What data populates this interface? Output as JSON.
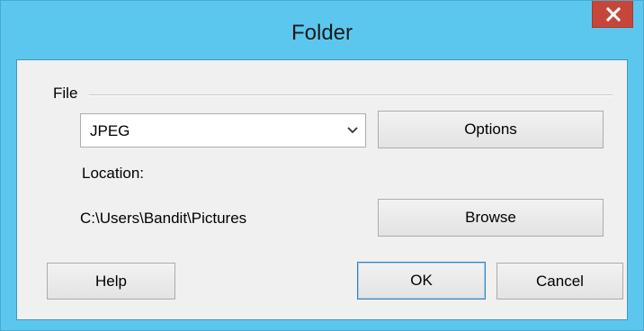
{
  "window": {
    "title": "Folder",
    "close_icon": "close-icon",
    "colors": {
      "titlebar": "#5cc7ee",
      "close_button": "#c7463a",
      "client_background": "#f0f0f0"
    }
  },
  "file_group": {
    "label": "File",
    "format_select": {
      "value": "JPEG",
      "arrow_icon": "chevron-down-icon"
    },
    "options_label": "Options"
  },
  "location": {
    "label": "Location:",
    "path": "C:\\Users\\Bandit\\Pictures",
    "browse_label": "Browse"
  },
  "footer": {
    "help_label": "Help",
    "ok_label": "OK",
    "cancel_label": "Cancel"
  }
}
